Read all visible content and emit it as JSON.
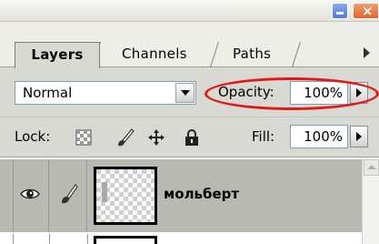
{
  "tabs": [
    {
      "label": "Layers"
    },
    {
      "label": "Channels"
    },
    {
      "label": "Paths"
    }
  ],
  "blend": {
    "mode": "Normal",
    "opacity_label": "Opacity:",
    "opacity_value": "100%"
  },
  "lock": {
    "label": "Lock:",
    "fill_label": "Fill:",
    "fill_value": "100%"
  },
  "layers": [
    {
      "name": "мольберт"
    }
  ],
  "colors": {
    "highlight_ellipse": "#e01818",
    "panel_bg": "#d9d9d3",
    "selected_row": "#b9b9b3"
  }
}
